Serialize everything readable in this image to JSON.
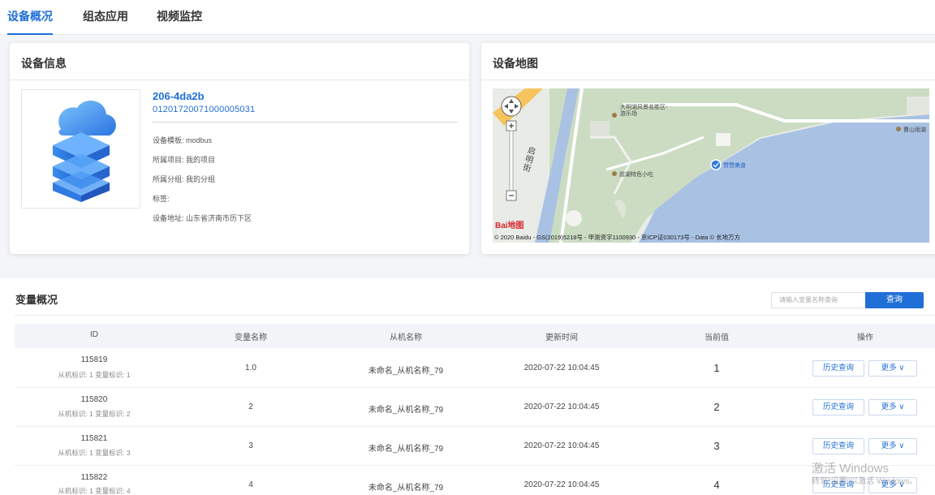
{
  "tabs": [
    {
      "label": "设备概况",
      "active": true
    },
    {
      "label": "组态应用",
      "active": false
    },
    {
      "label": "视频监控",
      "active": false
    }
  ],
  "device_info": {
    "title": "设备信息",
    "name": "206-4da2b",
    "serial": "01201720071000005031",
    "fields": [
      "设备模板: modbus",
      "所属项目: 我的项目",
      "所属分组: 我的分组",
      "标签:",
      "设备地址: 山东省济南市历下区"
    ]
  },
  "device_map": {
    "title": "设备地图",
    "labels": {
      "scenic": "大明湖风景名胜区-游乐场",
      "snack": "前湖特色小吃",
      "marker": "赞赞美食",
      "street": "启明街",
      "east": "曹山雨湖",
      "logo": "Bai地图"
    },
    "copyright": "© 2020 Baidu - GS(2019)5218号 - 甲测资字1100930 - 京ICP证030173号 - Data © 长地万方"
  },
  "variables": {
    "title": "变量概况",
    "search_placeholder": "请输入变量名称查询",
    "search_button": "查询",
    "columns": [
      "ID",
      "变量名称",
      "从机名称",
      "更新时间",
      "当前值",
      "操作"
    ],
    "rows": [
      {
        "id": "115819",
        "sub": "从机标识: 1    变量标识: 1",
        "name": "1.0",
        "slave": "未命名_从机名称_79",
        "time": "2020-07-22 10:04:45",
        "value": "1"
      },
      {
        "id": "115820",
        "sub": "从机标识: 1    变量标识: 2",
        "name": "2",
        "slave": "未命名_从机名称_79",
        "time": "2020-07-22 10:04:45",
        "value": "2"
      },
      {
        "id": "115821",
        "sub": "从机标识: 1    变量标识: 3",
        "name": "3",
        "slave": "未命名_从机名称_79",
        "time": "2020-07-22 10:04:45",
        "value": "3"
      },
      {
        "id": "115822",
        "sub": "从机标识: 1    变量标识: 4",
        "name": "4",
        "slave": "未命名_从机名称_79",
        "time": "2020-07-22 10:04:45",
        "value": "4"
      }
    ],
    "history_label": "历史查询",
    "more_label": "更多 ∨"
  },
  "watermark": {
    "line1": "激活 Windows",
    "line2": "转到\"设置\"以激活 Windows。"
  },
  "colors": {
    "accent": "#1f6fd6",
    "water": "#a9c2e4",
    "park": "#cbdcc3"
  }
}
